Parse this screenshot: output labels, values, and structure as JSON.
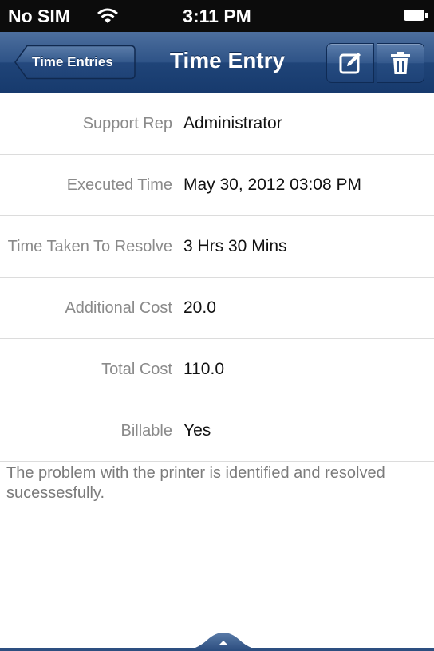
{
  "status_bar": {
    "carrier": "No SIM",
    "time": "3:11 PM"
  },
  "nav": {
    "back_label": "Time Entries",
    "title": "Time Entry"
  },
  "details": [
    {
      "label": "Support Rep",
      "value": "Administrator"
    },
    {
      "label": "Executed Time",
      "value": "May 30, 2012 03:08 PM"
    },
    {
      "label": "Time Taken To Resolve",
      "value": "3 Hrs 30 Mins"
    },
    {
      "label": "Additional Cost",
      "value": "20.0"
    },
    {
      "label": "Total Cost",
      "value": "110.0"
    },
    {
      "label": "Billable",
      "value": "Yes"
    }
  ],
  "note": "The problem with the printer is identified and resolved sucessesfully.",
  "colors": {
    "navbar": "#2e5387",
    "status_bar": "#0c0c0c",
    "label": "#8a8a8a"
  },
  "icons": [
    "wifi-icon",
    "battery-icon",
    "edit-icon",
    "trash-icon",
    "chevron-up-icon"
  ]
}
